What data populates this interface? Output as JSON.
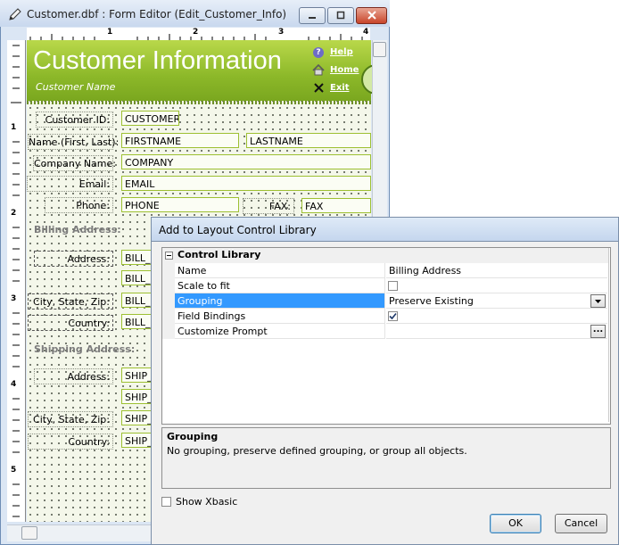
{
  "editor": {
    "title": "Customer.dbf : Form Editor (Edit_Customer_Info)",
    "title_icon": "pencil-icon",
    "window_buttons": {
      "minimize_icon": "minimize-icon",
      "maximize_icon": "maximize-icon",
      "close_icon": "close-icon"
    },
    "ruler_numbers": {
      "h": [
        "1",
        "2",
        "3",
        "4"
      ],
      "v": [
        "1",
        "2",
        "3",
        "4",
        "5"
      ]
    },
    "header": {
      "title": "Customer Information",
      "subtitle": "Customer Name",
      "links": [
        {
          "label": "Help",
          "icon": "help-icon"
        },
        {
          "label": "Home",
          "icon": "home-icon"
        },
        {
          "label": "Exit",
          "icon": "close-x-icon"
        }
      ]
    },
    "fields": {
      "customer_id": {
        "label": "Customer ID:",
        "value": "CUSTOMER_"
      },
      "name": {
        "label": "Name (First, Last):",
        "first": "FIRSTNAME",
        "last": "LASTNAME"
      },
      "company": {
        "label": "Company Name:",
        "value": "COMPANY"
      },
      "email": {
        "label": "Email:",
        "value": "EMAIL"
      },
      "phone": {
        "label": "Phone:",
        "value": "PHONE",
        "fax_label": "FAX:",
        "fax_value": "FAX"
      }
    },
    "billing": {
      "section": "Billing Address:",
      "address_label": "Address:",
      "address1": "BILL_",
      "address2": "BILL_",
      "csz_label": "City, State, Zip:",
      "csz": "BILL_C",
      "country_label": "Country:",
      "country": "BILL_C"
    },
    "shipping": {
      "section": "Shipping Address:",
      "address_label": "Address:",
      "address1": "SHIP_",
      "address2": "SHIP_",
      "csz_label": "City, State, Zip:",
      "csz": "SHIP_",
      "country_label": "Country:",
      "country": "SHIP_"
    }
  },
  "dialog": {
    "title": "Add to Layout Control Library",
    "category": "Control Library",
    "collapse_icon": "minus-box-icon",
    "properties": [
      {
        "name": "Name",
        "value": "Billing Address"
      },
      {
        "name": "Scale to fit",
        "checked": false
      },
      {
        "name": "Grouping",
        "value": "Preserve Existing",
        "selected": true
      },
      {
        "name": "Field Bindings",
        "checked": true
      },
      {
        "name": "Customize Prompt",
        "value": ""
      }
    ],
    "dropdown_icon": "dropdown-arrow-icon",
    "ellipsis": "...",
    "description": {
      "title": "Grouping",
      "text": "No grouping, preserve defined grouping, or group all objects."
    },
    "show_xbasic": "Show Xbasic",
    "ok_label": "OK",
    "cancel_label": "Cancel",
    "colors": {
      "selected_row": "#3399ff",
      "header_green": "#8cb829"
    }
  }
}
